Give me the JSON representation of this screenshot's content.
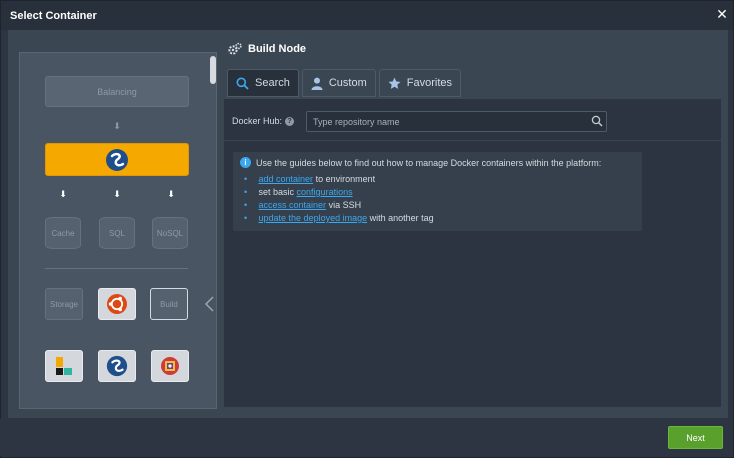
{
  "dialog": {
    "title": "Select Container",
    "close_glyph": "✕"
  },
  "topology": {
    "balancing_label": "Balancing",
    "databases": [
      "Cache",
      "SQL",
      "NoSQL"
    ],
    "storage_label": "Storage",
    "build_label": "Build"
  },
  "node": {
    "title": "Build Node",
    "icon": "gears-icon"
  },
  "tabs": [
    {
      "label": "Search",
      "icon": "search-icon",
      "active": true
    },
    {
      "label": "Custom",
      "icon": "user-icon",
      "active": false
    },
    {
      "label": "Favorites",
      "icon": "star-icon",
      "active": false
    }
  ],
  "search": {
    "label": "Docker Hub:",
    "help": "?",
    "placeholder": "Type repository name"
  },
  "info": {
    "icon": "i",
    "intro": "Use the guides below to find out how to manage Docker containers within the platform:",
    "items": [
      {
        "link": "add container",
        "rest": " to environment",
        "prefix": ""
      },
      {
        "link": "configurations",
        "rest": "",
        "prefix": "set basic "
      },
      {
        "link": "access container",
        "rest": " via SSH",
        "prefix": ""
      },
      {
        "link": "update the deployed image",
        "rest": " with another tag",
        "prefix": ""
      }
    ]
  },
  "footer": {
    "next_label": "Next"
  },
  "colors": {
    "accent": "#3aa8f0",
    "next": "#5aa02c",
    "app_server": "#f5a800"
  }
}
